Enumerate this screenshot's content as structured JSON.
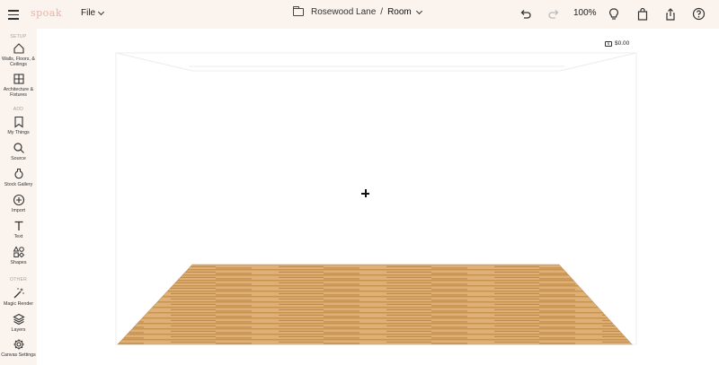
{
  "header": {
    "logo_text": "spoak",
    "file_label": "File",
    "project_name": "Rosewood Lane",
    "separator": "/",
    "room_name": "Room",
    "zoom": "100%"
  },
  "sidebar": {
    "sections": [
      "SETUP",
      "ADD",
      "OTHER"
    ],
    "items": [
      {
        "label": "Walls, Floors, & Ceilings",
        "icon": "house-icon"
      },
      {
        "label": "Architecture & Fixtures",
        "icon": "window-grid-icon"
      },
      {
        "label": "My Things",
        "icon": "bookmark-icon"
      },
      {
        "label": "Source",
        "icon": "search-icon"
      },
      {
        "label": "Stock Gallery",
        "icon": "vase-icon"
      },
      {
        "label": "Import",
        "icon": "plus-circle-icon"
      },
      {
        "label": "Text",
        "icon": "text-icon"
      },
      {
        "label": "Shapes",
        "icon": "shapes-icon"
      },
      {
        "label": "Magic Render",
        "icon": "magic-wand-icon"
      },
      {
        "label": "Layers",
        "icon": "layers-icon"
      },
      {
        "label": "Canvas Settings",
        "icon": "gear-icon"
      }
    ]
  },
  "canvas": {
    "cost": "$0.00",
    "floor_material": "light wood plank"
  },
  "colors": {
    "topbar_bg": "#faf3ee",
    "logo": "#e8b4a8",
    "floor_wood": "#d6a56a"
  }
}
